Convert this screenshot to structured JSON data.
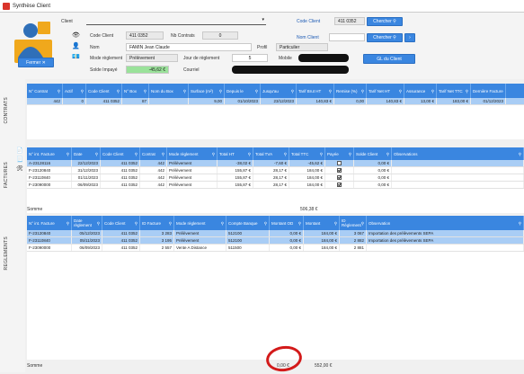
{
  "window": {
    "title": "Synthèse Client"
  },
  "header": {
    "client_label": "Client",
    "code_client_label": "Code Client",
    "code_client_value": "411 0352",
    "nb_contrats_label": "Nb Contrats",
    "nb_contrats_value": "0",
    "nom_label": "Nom",
    "nom_value": "FAMIN Jean Claude",
    "profil_label": "Profil",
    "profil_value": "Particulier",
    "mode_label": "Mode règlement",
    "mode_value": "Prélèvement",
    "jour_label": "Jour de règlement",
    "jour_value": "5",
    "mobile_label": "Mobile",
    "solde_label": "Solde Impayé",
    "solde_value": "-45,62 €",
    "courriel_label": "Courriel",
    "fermer_label": "Fermer",
    "gl_button": "GL du Client",
    "search_code_label": "Code Client",
    "search_code_value": "411 0352",
    "chercher1": "Chercher",
    "nom_client_label": "Nom Client",
    "chercher2": "Chercher"
  },
  "contrats": {
    "side_label": "CONTRATS",
    "columns": [
      "N° Contrat",
      "Actif",
      "Code Client",
      "N° Box",
      "Nom du Box",
      "Surface (m²)",
      "Depuis le",
      "Jusqu'au",
      "Tarif Brut HT",
      "Remise (%)",
      "Tarif Net HT",
      "Assurance",
      "Tarif Net TTC",
      "Dernière Facture"
    ],
    "rows": [
      [
        "442",
        "0",
        "411 0352",
        "87",
        "",
        "9,00",
        "01/10/2023",
        "23/12/2023",
        "140,83 €",
        "0,00",
        "140,83 €",
        "13,00 €",
        "183,00 €",
        "01/12/2023"
      ]
    ]
  },
  "factures": {
    "side_label": "FACTURES",
    "columns": [
      "N° int. Facture",
      "Date",
      "Code Client",
      "Contrat",
      "Mode règlement",
      "Total HT",
      "Total TVA",
      "Total TTC",
      "Payée",
      "Solde Client",
      "Observations"
    ],
    "rows": [
      [
        "A-23128116",
        "22/12/2023",
        "411 0352",
        "442",
        "Prélèvement",
        "-38,02 €",
        "-7,60 €",
        "-45,62 €",
        "0",
        "0,00 €",
        ""
      ],
      [
        "F-23120840",
        "31/12/2023",
        "411 0352",
        "442",
        "Prélèvement",
        "155,87 €",
        "28,17 €",
        "184,00 €",
        "1",
        "0,00 €",
        ""
      ],
      [
        "F-23110840",
        "01/11/2023",
        "411 0352",
        "442",
        "Prélèvement",
        "155,87 €",
        "28,17 €",
        "184,00 €",
        "1",
        "0,00 €",
        ""
      ],
      [
        "F-23090000",
        "06/09/2023",
        "411 0352",
        "442",
        "Prélèvement",
        "155,87 €",
        "28,17 €",
        "184,00 €",
        "1",
        "0,00 €",
        ""
      ]
    ],
    "somme_label": "Somme",
    "somme_value": "506,38 €"
  },
  "reglements": {
    "side_label": "REGLEMENTS",
    "columns": [
      "N° int. Facture",
      "Date règlement",
      "Code Client",
      "ID Facture",
      "Mode règlement",
      "Compte Banque",
      "Montant OD",
      "Montant",
      "ID Règlement",
      "Observation"
    ],
    "rows": [
      [
        "F-23120840",
        "05/12/2023",
        "411 0352",
        "3 283",
        "Prélèvement",
        "512100",
        "0,00 €",
        "184,00 €",
        "3 067",
        "Importation des prélèvements SEPA"
      ],
      [
        "F-23110840",
        "05/11/2023",
        "411 0352",
        "3 195",
        "Prélèvement",
        "512100",
        "0,00 €",
        "184,00 €",
        "2 882",
        "Importation des prélèvements SEPA"
      ],
      [
        "F-23090000",
        "06/09/2023",
        "411 0352",
        "2 557",
        "Vente A Distance",
        "511500",
        "0,00 €",
        "184,00 €",
        "2 881",
        ""
      ]
    ],
    "somme_label": "Somme",
    "somme_od": "0,00 €",
    "somme_montant": "552,00 €"
  }
}
